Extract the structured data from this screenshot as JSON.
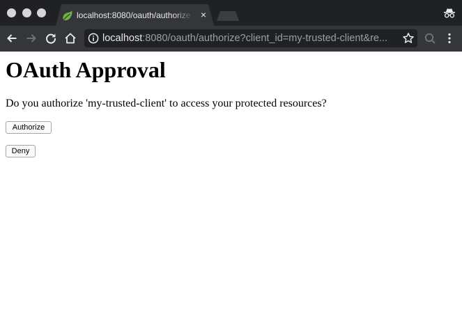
{
  "browser": {
    "tab": {
      "title": "localhost:8080/oauth/authorize",
      "favicon": "spring-leaf-icon",
      "close_icon": "×"
    },
    "toolbar": {
      "url_host": "localhost",
      "url_rest": ":8080/oauth/authorize?client_id=my-trusted-client&re...",
      "icons": [
        "back-arrow-icon",
        "forward-arrow-icon",
        "reload-icon",
        "home-icon",
        "info-icon",
        "star-icon",
        "lens-icon",
        "menu-icon",
        "incognito-icon"
      ]
    },
    "colors": {
      "frame": "#202124",
      "toolbar": "#35363a",
      "text": "#e8eaed",
      "favicon": "#6db33f"
    }
  },
  "page": {
    "heading": "OAuth Approval",
    "prompt": "Do you authorize 'my-trusted-client' to access your protected resources?",
    "authorize_label": "Authorize",
    "deny_label": "Deny"
  }
}
